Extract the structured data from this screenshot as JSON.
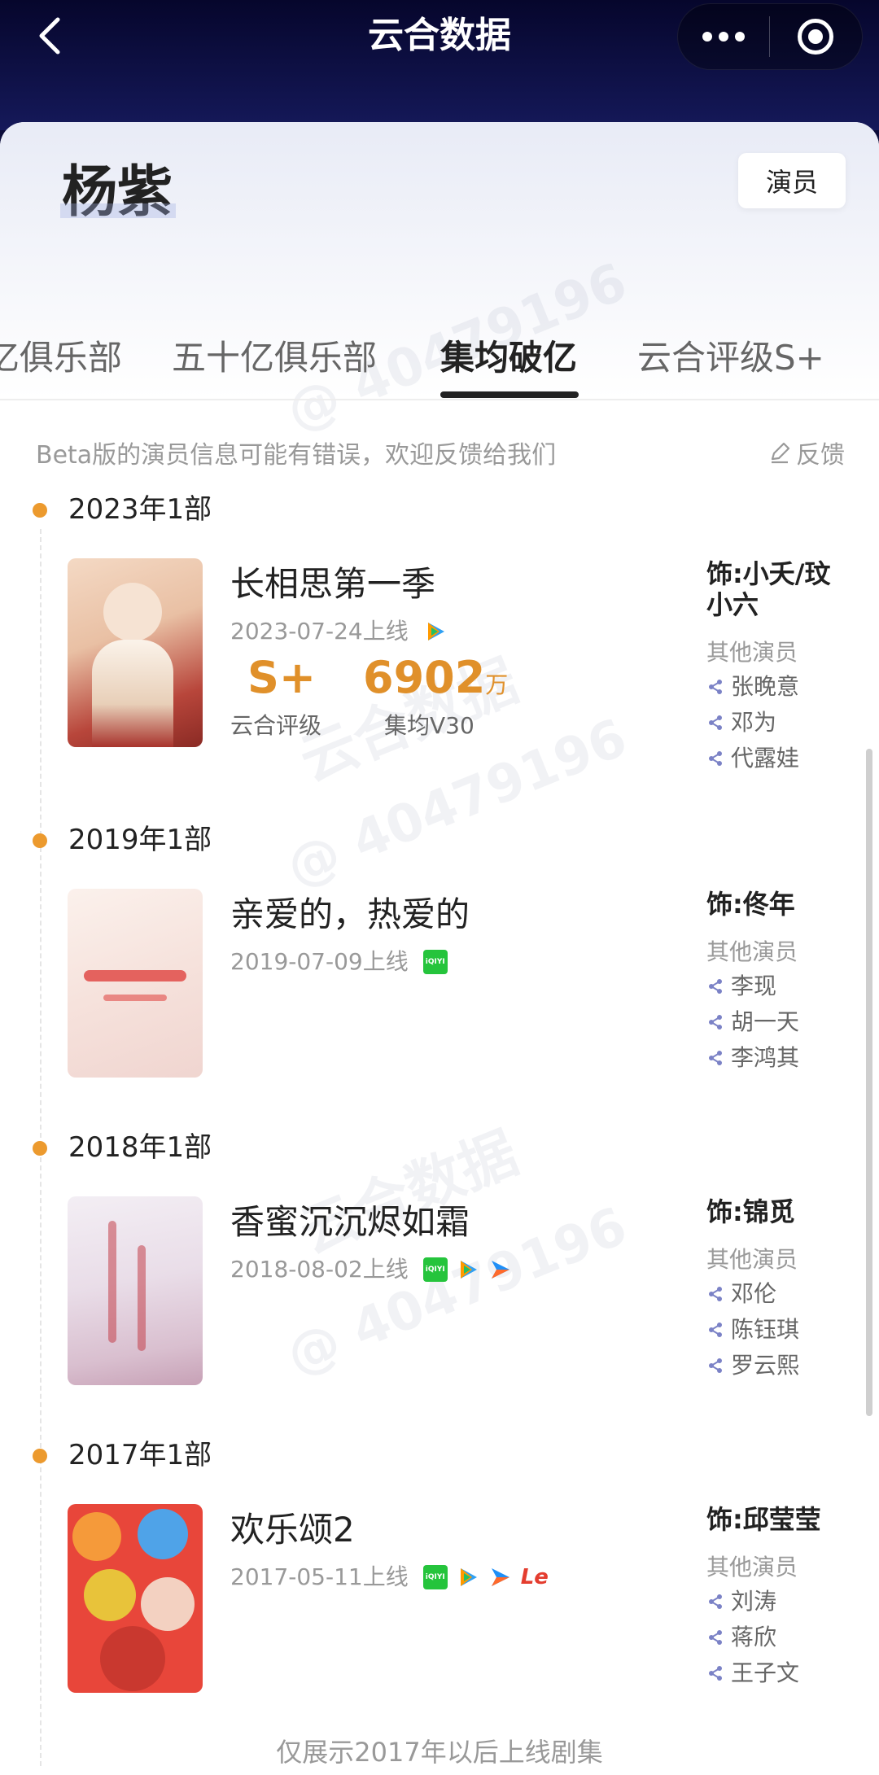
{
  "app": {
    "title": "云合数据"
  },
  "header": {
    "actor_name": "杨紫",
    "role_badge": "演员",
    "watermark": "@ 40479196"
  },
  "tabs": [
    {
      "label": "亿俱乐部"
    },
    {
      "label": "五十亿俱乐部"
    },
    {
      "label": "集均破亿",
      "active": true
    },
    {
      "label": "云合评级S+"
    }
  ],
  "notice": "Beta版的演员信息可能有错误，欢迎反馈给我们",
  "feedback_label": "反馈",
  "footer": "仅展示2017年以后上线剧集",
  "colors": {
    "accent": "#e0902a",
    "dot": "#ec9a2e",
    "topbar": "#0d0d3a"
  },
  "years": [
    {
      "label": "2023年1部",
      "show": {
        "title": "长相思第一季",
        "date": "2023-07-24上线",
        "platforms": [
          "tencent"
        ],
        "rating_value": "S+",
        "rating_label": "云合评级",
        "avg_value": "6902",
        "avg_unit": "万",
        "avg_label": "集均V30",
        "role": "饰:小夭/玟小六",
        "others_label": "其他演员",
        "cast": [
          "张晚意",
          "邓为",
          "代露娃"
        ]
      }
    },
    {
      "label": "2019年1部",
      "show": {
        "title": "亲爱的，热爱的",
        "date": "2019-07-09上线",
        "platforms": [
          "iqiyi"
        ],
        "role": "饰:佟年",
        "others_label": "其他演员",
        "cast": [
          "李现",
          "胡一天",
          "李鸿其"
        ]
      }
    },
    {
      "label": "2018年1部",
      "show": {
        "title": "香蜜沉沉烬如霜",
        "date": "2018-08-02上线",
        "platforms": [
          "iqiyi",
          "tencent",
          "youku"
        ],
        "role": "饰:锦觅",
        "others_label": "其他演员",
        "cast": [
          "邓伦",
          "陈钰琪",
          "罗云熙"
        ]
      }
    },
    {
      "label": "2017年1部",
      "show": {
        "title": "欢乐颂2",
        "date": "2017-05-11上线",
        "platforms": [
          "iqiyi",
          "tencent",
          "youku",
          "le"
        ],
        "role": "饰:邱莹莹",
        "others_label": "其他演员",
        "cast": [
          "刘涛",
          "蒋欣",
          "王子文"
        ]
      }
    }
  ]
}
